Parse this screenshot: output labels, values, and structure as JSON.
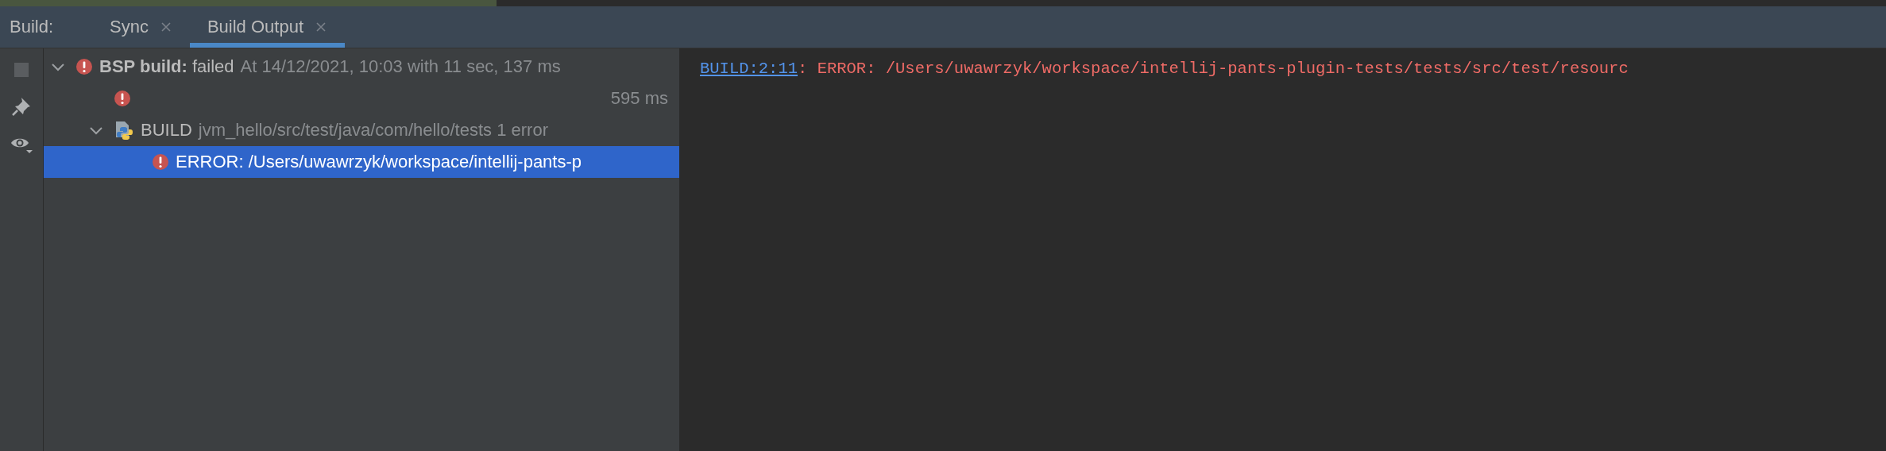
{
  "tool_window": {
    "title": "Build:"
  },
  "tabs": [
    {
      "label": "Sync",
      "selected": false
    },
    {
      "label": "Build Output",
      "selected": true
    }
  ],
  "toolbar": [
    {
      "kind": "stop",
      "disabled": true
    },
    {
      "kind": "pin",
      "disabled": false
    },
    {
      "kind": "view",
      "disabled": false
    }
  ],
  "tree": [
    {
      "kind": "error",
      "text": "**BSP build:** failed",
      "hint": "At 14/12/2021, 10:03 with 11 sec, 137 ms",
      "expanded": true,
      "selected": false,
      "children": [
        {
          "kind": "error",
          "time": "595 ms",
          "selected": false
        },
        {
          "kind": "python",
          "text": "BUILD",
          "hint": "jvm_hello/src/test/java/com/hello/tests 1 error",
          "expanded": true,
          "selected": false,
          "children": [
            {
              "kind": "error",
              "text": "ERROR: /Users/uwawrzyk/workspace/intellij-pants-p",
              "selected": true
            }
          ]
        }
      ]
    }
  ],
  "console": {
    "link": "BUILD:2:11",
    "message": ": ERROR: /Users/uwawrzyk/workspace/intellij-pants-plugin-tests/tests/src/test/resourc"
  }
}
